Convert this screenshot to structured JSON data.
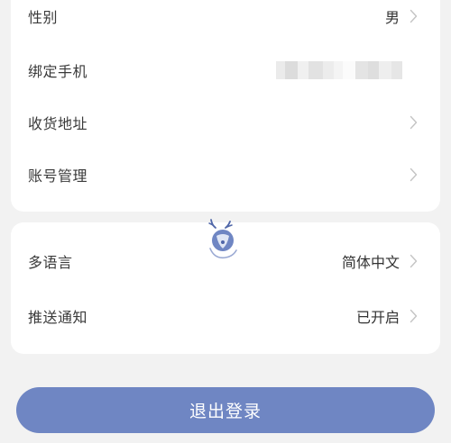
{
  "profile": {
    "items": [
      {
        "label": "性别",
        "value": "男",
        "has_chevron": true
      },
      {
        "label": "绑定手机",
        "value": "",
        "blurred": true,
        "has_chevron": false
      },
      {
        "label": "收货地址",
        "value": "",
        "has_chevron": true
      },
      {
        "label": "账号管理",
        "value": "",
        "has_chevron": true
      }
    ]
  },
  "settings": {
    "items": [
      {
        "label": "多语言",
        "value": "简体中文",
        "has_chevron": true
      },
      {
        "label": "推送通知",
        "value": "已开启",
        "has_chevron": true
      }
    ]
  },
  "logout": {
    "label": "退出登录"
  },
  "colors": {
    "accent": "#6f86c3",
    "background": "#f2f2f2",
    "card": "#ffffff",
    "chevron": "#c4c4c4"
  },
  "icons": {
    "chevron": "chevron-right-icon",
    "loader": "deer-loading-icon"
  }
}
